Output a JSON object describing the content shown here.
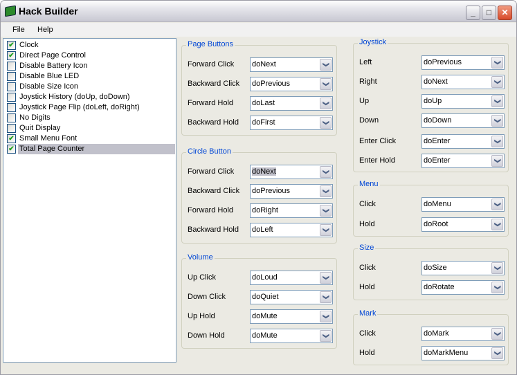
{
  "window": {
    "title": "Hack Builder",
    "minimize": "_",
    "maximize": "□",
    "close": "✕"
  },
  "menu": [
    "File",
    "Help"
  ],
  "hacks": [
    {
      "label": "Clock",
      "checked": true
    },
    {
      "label": "Direct Page Control",
      "checked": true
    },
    {
      "label": "Disable Battery Icon",
      "checked": false
    },
    {
      "label": "Disable Blue LED",
      "checked": false
    },
    {
      "label": "Disable Size Icon",
      "checked": false
    },
    {
      "label": "Joystick History (doUp, doDown)",
      "checked": false
    },
    {
      "label": "Joystick Page Flip (doLeft, doRight)",
      "checked": false
    },
    {
      "label": "No Digits",
      "checked": false
    },
    {
      "label": "Quit Display",
      "checked": false
    },
    {
      "label": "Small Menu Font",
      "checked": true
    },
    {
      "label": "Total Page Counter",
      "checked": true,
      "selected": true
    }
  ],
  "groups": [
    {
      "title": "Page Buttons",
      "rows": [
        {
          "label": "Forward Click",
          "value": "doNext"
        },
        {
          "label": "Backward Click",
          "value": "doPrevious"
        },
        {
          "label": "Forward Hold",
          "value": "doLast"
        },
        {
          "label": "Backward Hold",
          "value": "doFirst"
        }
      ]
    },
    {
      "title": "Circle Button",
      "rows": [
        {
          "label": "Forward Click",
          "value": "doNext",
          "highlighted": true
        },
        {
          "label": "Backward Click",
          "value": "doPrevious"
        },
        {
          "label": "Forward Hold",
          "value": "doRight"
        },
        {
          "label": "Backward Hold",
          "value": "doLeft"
        }
      ]
    },
    {
      "title": "Volume",
      "rows": [
        {
          "label": "Up Click",
          "value": "doLoud"
        },
        {
          "label": "Down Click",
          "value": "doQuiet"
        },
        {
          "label": "Up Hold",
          "value": "doMute"
        },
        {
          "label": "Down Hold",
          "value": "doMute"
        }
      ]
    },
    {
      "title": "Joystick",
      "rows": [
        {
          "label": "Left",
          "value": "doPrevious"
        },
        {
          "label": "Right",
          "value": "doNext"
        },
        {
          "label": "Up",
          "value": "doUp"
        },
        {
          "label": "Down",
          "value": "doDown"
        },
        {
          "label": "Enter Click",
          "value": "doEnter"
        },
        {
          "label": "Enter Hold",
          "value": "doEnter"
        }
      ]
    },
    {
      "title": "Menu",
      "rows": [
        {
          "label": "Click",
          "value": "doMenu"
        },
        {
          "label": "Hold",
          "value": "doRoot"
        }
      ]
    },
    {
      "title": "Size",
      "rows": [
        {
          "label": "Click",
          "value": "doSize"
        },
        {
          "label": "Hold",
          "value": "doRotate"
        }
      ]
    },
    {
      "title": "Mark",
      "rows": [
        {
          "label": "Click",
          "value": "doMark"
        },
        {
          "label": "Hold",
          "value": "doMarkMenu"
        }
      ]
    }
  ]
}
